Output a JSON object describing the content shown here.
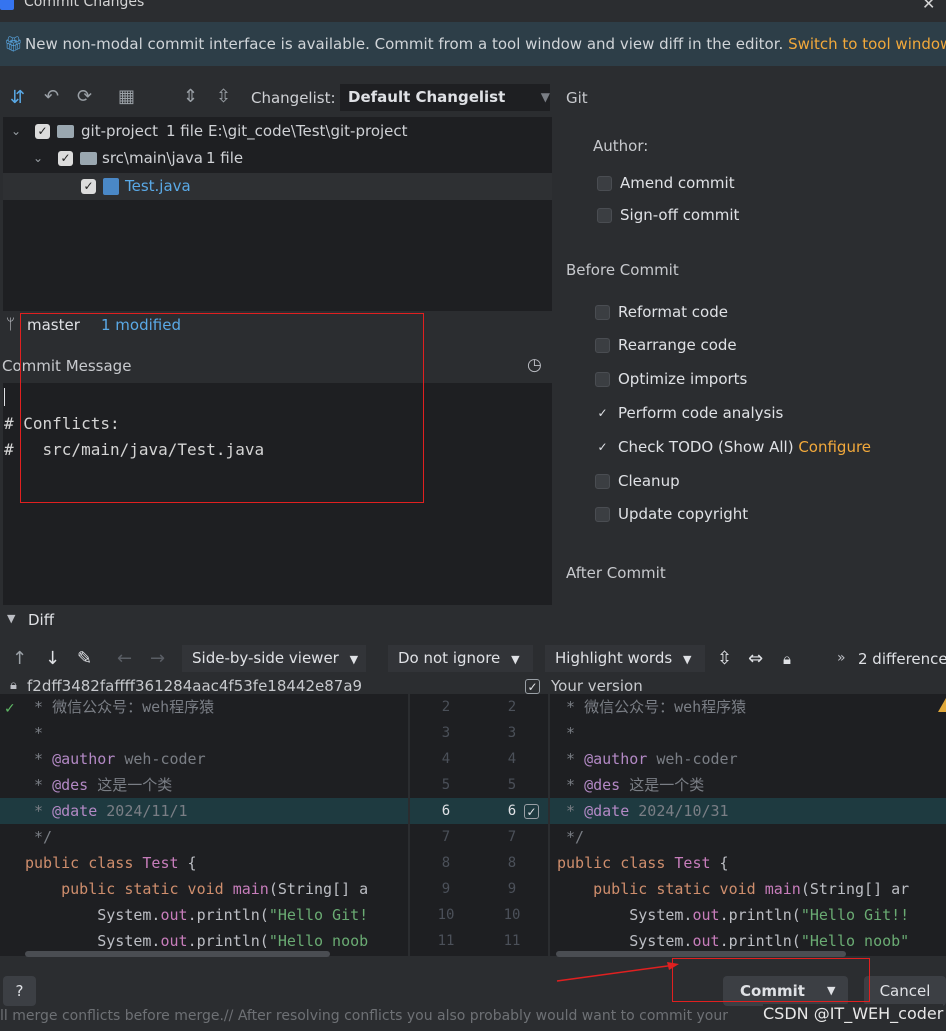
{
  "window": {
    "title": "Commit Changes"
  },
  "banner": {
    "text": "New non-modal commit interface is available. Commit from a tool window and view diff in the editor.",
    "link": "Switch to tool window"
  },
  "toolbar": {
    "changelist_label": "Changelist:",
    "changelist_value": "Default Changelist"
  },
  "tree": {
    "root": {
      "name": "git-project",
      "count": "1 file",
      "path": "E:\\git_code\\Test\\git-project"
    },
    "folder": {
      "name": "src\\main\\java",
      "count": "1 file"
    },
    "file": {
      "name": "Test.java"
    }
  },
  "branch": {
    "name": "master",
    "status": "1 modified"
  },
  "commit_message": {
    "label": "Commit Message",
    "lines": [
      "# Conflicts:",
      "#   src/main/java/Test.java"
    ]
  },
  "git_panel": {
    "title": "Git",
    "author_label": "Author:",
    "amend": "Amend commit",
    "signoff": "Sign-off commit",
    "before_commit": "Before Commit",
    "options": [
      {
        "label": "Reformat code",
        "checked": false
      },
      {
        "label": "Rearrange code",
        "checked": false
      },
      {
        "label": "Optimize imports",
        "checked": false
      },
      {
        "label": "Perform code analysis",
        "checked": true
      },
      {
        "label": "Check TODO (Show All)",
        "checked": true,
        "link": "Configure"
      },
      {
        "label": "Cleanup",
        "checked": false
      },
      {
        "label": "Update copyright",
        "checked": false
      }
    ],
    "after_commit": "After Commit"
  },
  "diff": {
    "title": "Diff",
    "viewer": "Side-by-side viewer",
    "ignore": "Do not ignore",
    "highlight": "Highlight words",
    "differences": "2 difference",
    "left_header": "f2dff3482faffff361284aac4f53fe18442e87a9",
    "right_header": "Your version",
    "left_nums": [
      "2",
      "3",
      "4",
      "5",
      "6",
      "7",
      "8",
      "9",
      "10",
      "11"
    ],
    "right_nums": [
      "2",
      "3",
      "4",
      "5",
      "6",
      "7",
      "8",
      "9",
      "10",
      "11"
    ],
    "left_lines": [
      [
        {
          "t": " * 微信公众号：weh程序猿",
          "c": "cm"
        }
      ],
      [
        {
          "t": " *",
          "c": "cm"
        }
      ],
      [
        {
          "t": " * ",
          "c": "cm"
        },
        {
          "t": "@author",
          "c": "ann"
        },
        {
          "t": " weh-coder",
          "c": "cm"
        }
      ],
      [
        {
          "t": " * ",
          "c": "cm"
        },
        {
          "t": "@des",
          "c": "ann"
        },
        {
          "t": " 这是一个类",
          "c": "cm"
        }
      ],
      [
        {
          "t": " * ",
          "c": "cm"
        },
        {
          "t": "@date",
          "c": "ann"
        },
        {
          "t": " 2024/11/1",
          "c": "cm"
        }
      ],
      [
        {
          "t": " */",
          "c": "cm"
        }
      ],
      [
        {
          "t": "public class ",
          "c": "kw"
        },
        {
          "t": "Test",
          "c": "cls"
        },
        {
          "t": " {",
          "c": "plain"
        }
      ],
      [
        {
          "t": "    public static void ",
          "c": "kw"
        },
        {
          "t": "main",
          "c": "cls"
        },
        {
          "t": "(String[] a",
          "c": "plain"
        }
      ],
      [
        {
          "t": "        System.",
          "c": "plain"
        },
        {
          "t": "out",
          "c": "cls"
        },
        {
          "t": ".println(",
          "c": "plain"
        },
        {
          "t": "\"Hello Git!",
          "c": "str"
        }
      ],
      [
        {
          "t": "        System.",
          "c": "plain"
        },
        {
          "t": "out",
          "c": "cls"
        },
        {
          "t": ".println(",
          "c": "plain"
        },
        {
          "t": "\"Hello noob",
          "c": "str"
        }
      ]
    ],
    "right_lines": [
      [
        {
          "t": " * 微信公众号：weh程序猿",
          "c": "cm"
        }
      ],
      [
        {
          "t": " *",
          "c": "cm"
        }
      ],
      [
        {
          "t": " * ",
          "c": "cm"
        },
        {
          "t": "@author",
          "c": "ann"
        },
        {
          "t": " weh-coder",
          "c": "cm"
        }
      ],
      [
        {
          "t": " * ",
          "c": "cm"
        },
        {
          "t": "@des",
          "c": "ann"
        },
        {
          "t": " 这是一个类",
          "c": "cm"
        }
      ],
      [
        {
          "t": " * ",
          "c": "cm"
        },
        {
          "t": "@date",
          "c": "ann"
        },
        {
          "t": " 2024/10/31",
          "c": "cm"
        }
      ],
      [
        {
          "t": " */",
          "c": "cm"
        }
      ],
      [
        {
          "t": "public class ",
          "c": "kw"
        },
        {
          "t": "Test",
          "c": "cls"
        },
        {
          "t": " {",
          "c": "plain"
        }
      ],
      [
        {
          "t": "    public static void ",
          "c": "kw"
        },
        {
          "t": "main",
          "c": "cls"
        },
        {
          "t": "(String[] ar",
          "c": "plain"
        }
      ],
      [
        {
          "t": "        System.",
          "c": "plain"
        },
        {
          "t": "out",
          "c": "cls"
        },
        {
          "t": ".println(",
          "c": "plain"
        },
        {
          "t": "\"Hello Git!!",
          "c": "str"
        }
      ],
      [
        {
          "t": "        System.",
          "c": "plain"
        },
        {
          "t": "out",
          "c": "cls"
        },
        {
          "t": ".println(",
          "c": "plain"
        },
        {
          "t": "\"Hello noob\"",
          "c": "str"
        }
      ]
    ]
  },
  "footer": {
    "help": "?",
    "commit": "Commit",
    "cancel": "Cancel",
    "background_text": "ll merge conflicts before merge.// After resolving conflicts you also probably would want to commit your",
    "watermark": "CSDN @IT_WEH_coder"
  }
}
